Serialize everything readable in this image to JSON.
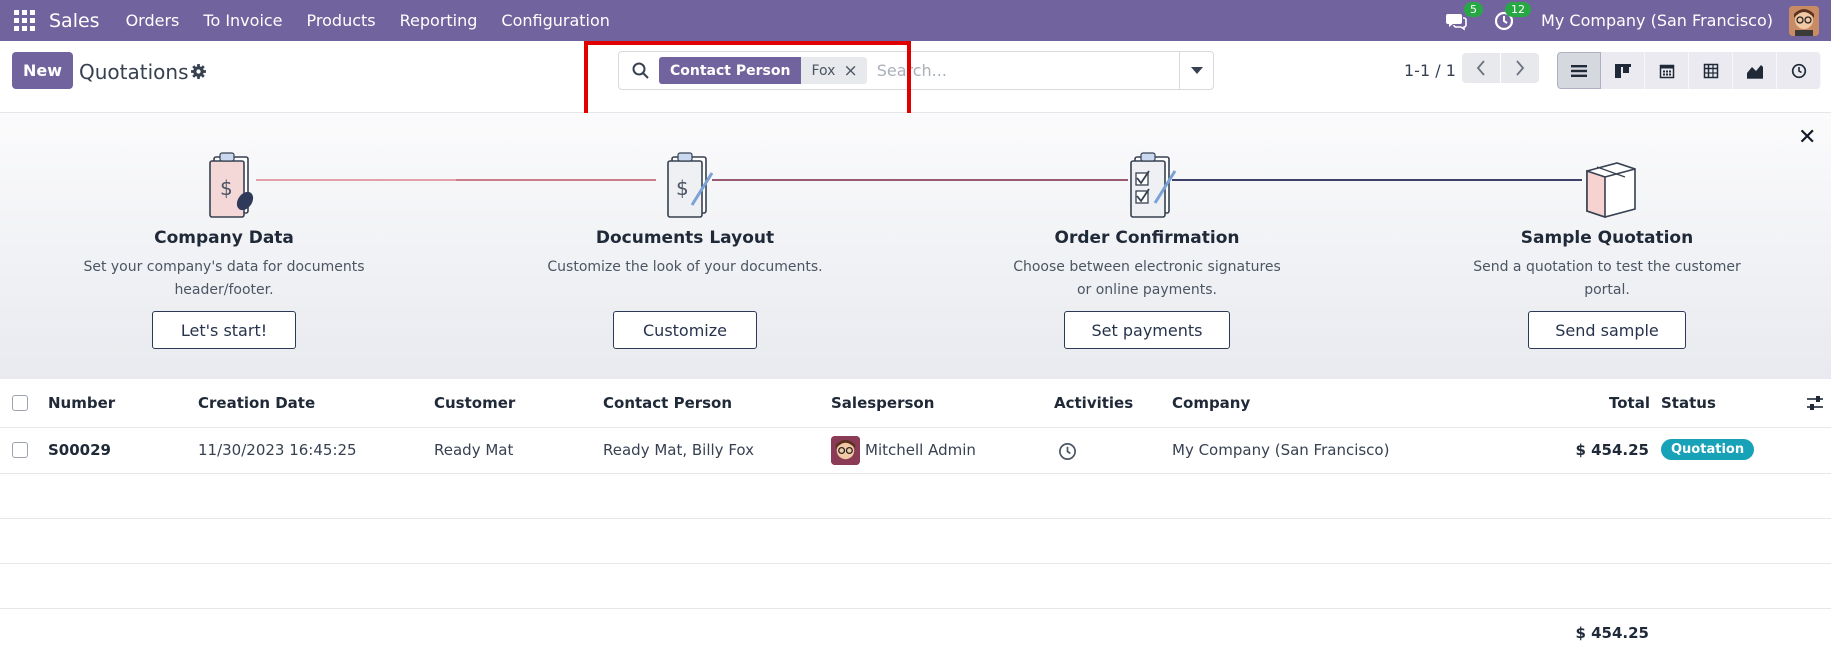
{
  "navbar": {
    "app_name": "Sales",
    "menu": [
      "Orders",
      "To Invoice",
      "Products",
      "Reporting",
      "Configuration"
    ],
    "messages_count": "5",
    "activities_count": "12",
    "company": "My Company (San Francisco)"
  },
  "control": {
    "new_label": "New",
    "title": "Quotations",
    "search": {
      "facet_label": "Contact Person",
      "facet_value": "Fox",
      "placeholder": "Search..."
    },
    "pager": "1-1 / 1"
  },
  "onboarding": {
    "steps": [
      {
        "title": "Company Data",
        "desc": "Set your company's data for documents header/footer.",
        "button": "Let's start!"
      },
      {
        "title": "Documents Layout",
        "desc": "Customize the look of your documents.",
        "button": "Customize"
      },
      {
        "title": "Order Confirmation",
        "desc": "Choose between electronic signatures or online payments.",
        "button": "Set payments"
      },
      {
        "title": "Sample Quotation",
        "desc": "Send a quotation to test the customer portal.",
        "button": "Send sample"
      }
    ]
  },
  "table": {
    "columns": [
      "Number",
      "Creation Date",
      "Customer",
      "Contact Person",
      "Salesperson",
      "Activities",
      "Company",
      "Total",
      "Status"
    ],
    "rows": [
      {
        "number": "S00029",
        "creation_date": "11/30/2023 16:45:25",
        "customer": "Ready Mat",
        "contact_person": "Ready Mat, Billy Fox",
        "salesperson": "Mitchell Admin",
        "company": "My Company (San Francisco)",
        "total": "$ 454.25",
        "status": "Quotation"
      }
    ],
    "footer_total": "$ 454.25"
  },
  "colors": {
    "brand": "#71639e",
    "status_quotation": "#17a2b8",
    "badge_green": "#28a745",
    "highlight": "#e10000"
  },
  "icons": [
    "apps-icon",
    "chat-icon",
    "activity-clock-icon",
    "gear-icon",
    "search-icon",
    "close-icon",
    "list-view-icon",
    "kanban-view-icon",
    "calendar-view-icon",
    "pivot-view-icon",
    "graph-view-icon",
    "activity-view-icon",
    "optional-columns-icon"
  ]
}
